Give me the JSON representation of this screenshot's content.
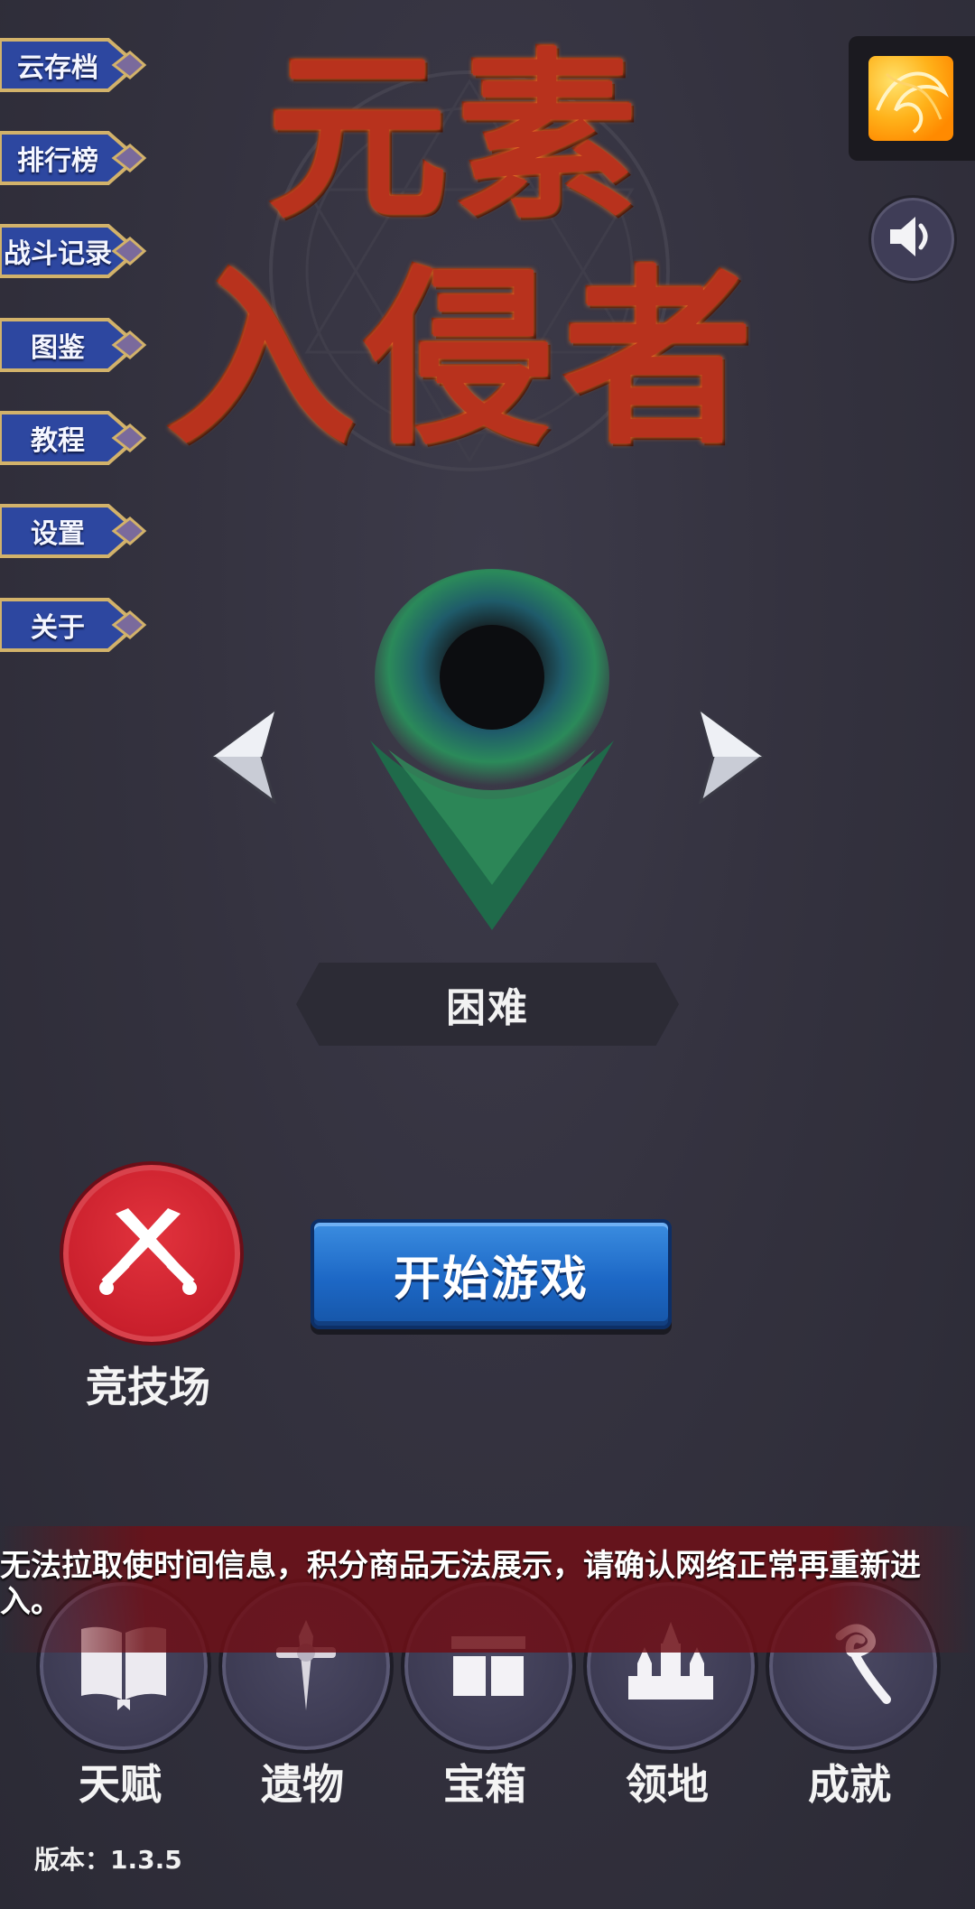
{
  "game_title": {
    "line1": "元素",
    "line2": "入侵者"
  },
  "side_menu": {
    "items": [
      {
        "label": "云存档"
      },
      {
        "label": "排行榜"
      },
      {
        "label": "战斗记录"
      },
      {
        "label": "图鉴"
      },
      {
        "label": "教程"
      },
      {
        "label": "设置"
      },
      {
        "label": "关于"
      }
    ]
  },
  "difficulty": {
    "label": "困难"
  },
  "arena": {
    "label": "竞技场",
    "icon": "crossed-swords-icon"
  },
  "start": {
    "label": "开始游戏"
  },
  "notice": {
    "text": "无法拉取使时间信息，积分商品无法展示，请确认网络正常再重新进入。"
  },
  "bottom_nav": {
    "items": [
      {
        "label": "天赋",
        "icon": "book-icon"
      },
      {
        "label": "遗物",
        "icon": "relic-sword-icon"
      },
      {
        "label": "宝箱",
        "icon": "chest-icon"
      },
      {
        "label": "领地",
        "icon": "castle-icon"
      },
      {
        "label": "成就",
        "icon": "achievement-icon"
      }
    ]
  },
  "version": {
    "text": "版本：1.3.5"
  },
  "colors": {
    "background": "#34323f",
    "title_red": "#b8321d",
    "arena_red": "#d42a36",
    "start_blue": "#1d68c6",
    "menu_blue": "#2d47a0"
  }
}
